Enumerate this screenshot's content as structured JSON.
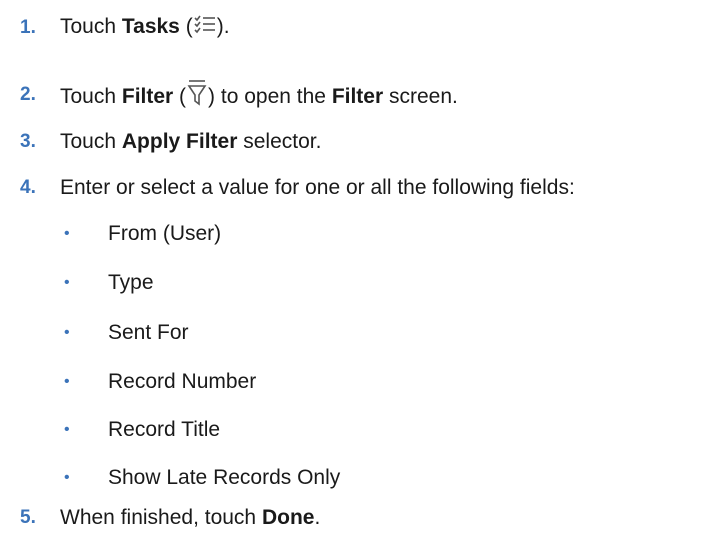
{
  "steps": [
    {
      "num": "1.",
      "pre": "Touch ",
      "bold": "Tasks",
      "mid": " (",
      "icon": "tasks-list-icon",
      "post": ")."
    },
    {
      "num": "2.",
      "pre": "Touch ",
      "bold": "Filter",
      "mid": " (",
      "icon": "filter-funnel-icon",
      "post": ") to open the ",
      "bold2": "Filter",
      "post2": " screen."
    },
    {
      "num": "3.",
      "pre": "Touch ",
      "bold": "Apply Filter",
      "post": " selector."
    },
    {
      "num": "4.",
      "text": "Enter or select a value for one or all the following fields:"
    },
    {
      "num": "5.",
      "pre": "When finished, touch ",
      "bold": "Done",
      "post": "."
    }
  ],
  "fields": [
    "From (User)",
    "Type",
    "Sent For",
    "Record Number",
    "Record Title",
    "Show Late Records Only"
  ],
  "bullet_char": "•",
  "colors": {
    "accent": "#3b73b9",
    "text": "#1a1a1a",
    "icon": "#555555"
  }
}
